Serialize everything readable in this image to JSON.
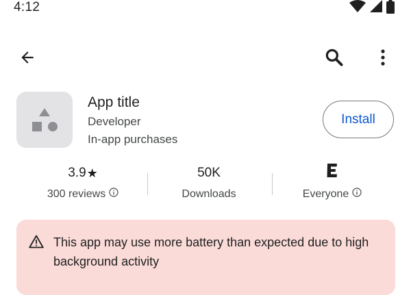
{
  "status_bar": {
    "time": "4:12",
    "icons": [
      "wifi-icon",
      "cell-signal-icon",
      "battery-icon"
    ]
  },
  "app_bar": {
    "icons": [
      "arrow-back-icon",
      "search-icon",
      "more-vert-icon"
    ]
  },
  "app": {
    "icon": "app-placeholder-icon",
    "title": "App title",
    "developer": "Developer",
    "in_app": "In-app purchases",
    "install_label": "Install"
  },
  "stats": {
    "rating": {
      "value": "3.9",
      "star": "★",
      "label": "300 reviews",
      "info_icon": "info-icon"
    },
    "downloads": {
      "value": "50K",
      "label": "Downloads"
    },
    "age": {
      "badge": "E",
      "label": "Everyone",
      "info_icon": "info-icon"
    }
  },
  "warning": {
    "icon": "warning-icon",
    "text": "This app may use more battery than expected due to high background activity"
  },
  "colors": {
    "accent": "#0b57d0",
    "text_primary": "#1f1f1f",
    "text_secondary": "#444746",
    "warning_bg": "#fadbd8",
    "icon_bg": "#e3e3e6",
    "icon_shape": "#8d8f92"
  }
}
